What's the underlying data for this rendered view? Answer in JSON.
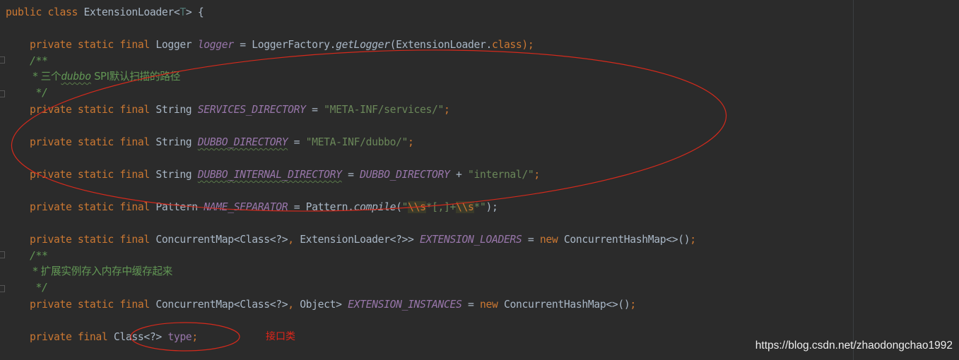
{
  "code": {
    "class_decl": {
      "public": "public",
      "class": "class",
      "name": "ExtensionLoader<",
      "type_param": "T",
      "close": "> {"
    },
    "logger_line": {
      "mods": "private static final ",
      "type": "Logger ",
      "field": "logger",
      "eq": " = LoggerFactory.",
      "method": "getLogger",
      "arg": "(ExtensionLoader.",
      "kw_class": "class",
      "end": ");"
    },
    "comment1_open": "/**",
    "comment1_body": {
      "prefix": " * 三个",
      "word": "dubbo",
      "rest": " SPI默认扫描的路径"
    },
    "comment1_close": " */",
    "services_line": {
      "mods": "private static final ",
      "type": "String ",
      "field": "SERVICES_DIRECTORY",
      "eq": " = ",
      "value": "\"META-INF/services/\"",
      "end": ";"
    },
    "dubbo_line": {
      "mods": "private static final ",
      "type": "String ",
      "field": "DUBBO_DIRECTORY",
      "eq": " = ",
      "value": "\"META-INF/dubbo/\"",
      "end": ";"
    },
    "internal_line": {
      "mods": "private static final ",
      "type": "String ",
      "field": "DUBBO_INTERNAL_DIRECTORY",
      "eq": " = ",
      "ref": "DUBBO_DIRECTORY",
      "plus": " + ",
      "value": "\"internal/\"",
      "end": ";"
    },
    "separator_line": {
      "mods": "private static final ",
      "type": "Pattern ",
      "field": "NAME_SEPARATOR",
      "eq": " = Pattern.",
      "method": "compile",
      "open": "(",
      "q1": "\"",
      "e1": "\\\\s",
      "star1": "*[,]+",
      "e2": "\\\\s",
      "star2": "*",
      "q2": "\"",
      "end": ");"
    },
    "loaders_line": {
      "mods": "private static final ",
      "type": "ConcurrentMap<Class<?>",
      "comma": ", ",
      "type2": "ExtensionLoader<?>> ",
      "field": "EXTENSION_LOADERS",
      "eq": " = ",
      "new": "new",
      "ctor": " ConcurrentHashMap<>()",
      "end": ";"
    },
    "comment2_open": "/**",
    "comment2_body": " * 扩展实例存入内存中缓存起来",
    "comment2_close": " */",
    "instances_line": {
      "mods": "private static final ",
      "type": "ConcurrentMap<Class<?>",
      "comma": ", ",
      "type2": "Object> ",
      "field": "EXTENSION_INSTANCES",
      "eq": " = ",
      "new": "new",
      "ctor": " ConcurrentHashMap<>()",
      "end": ";"
    },
    "type_line": {
      "mods": "private final ",
      "type": "Class<?> ",
      "field": "type",
      "end": ";"
    }
  },
  "annotation_label": "接口类",
  "watermark": "https://blog.csdn.net/zhaodongchao1992",
  "colors": {
    "background": "#2b2b2b",
    "keyword": "#cc7832",
    "string": "#6a8759",
    "static_field": "#9876aa",
    "comment": "#629755",
    "annotation_ink": "#e0261a"
  }
}
